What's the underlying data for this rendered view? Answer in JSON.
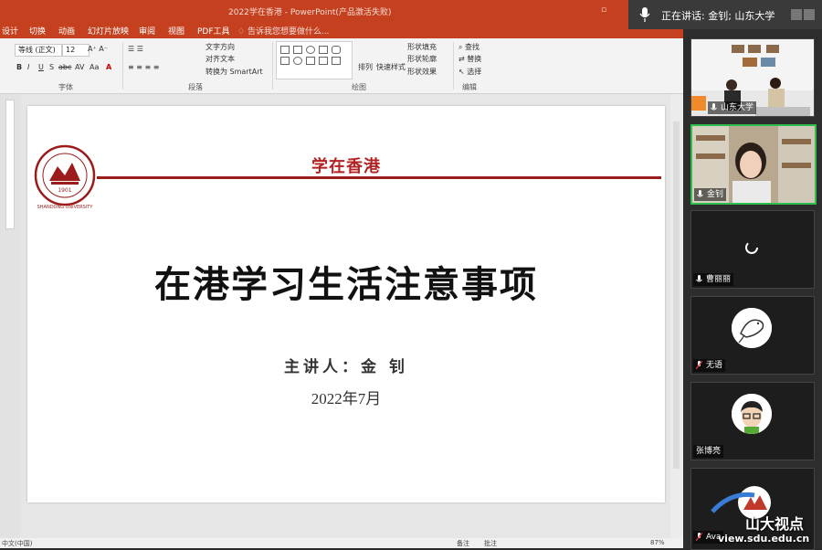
{
  "app": {
    "window_title": "2022学在香港 - PowerPoint(产品激活失败)",
    "tabs": [
      "设计",
      "切换",
      "动画",
      "幻灯片放映",
      "审阅",
      "视图",
      "PDF工具"
    ],
    "tell_me": "告诉我您想要做什么...",
    "ribbon": {
      "font_name": "等线 (正文)",
      "font_size": "12",
      "text_direction": "文字方向",
      "align_text": "对齐文本",
      "convert_smartart": "转换为 SmartArt",
      "arrange": "排列",
      "quick_styles": "快速样式",
      "shape_fill": "形状填充",
      "shape_outline": "形状轮廓",
      "shape_effects": "形状效果",
      "find": "查找",
      "replace": "替换",
      "select": "选择",
      "groups": [
        "字体",
        "段落",
        "绘图",
        "编辑"
      ]
    },
    "status": {
      "left": "中文(中国)",
      "notes": "备注",
      "comments": "批注",
      "zoom": "87%"
    }
  },
  "slide": {
    "header": "学在香港",
    "title": "在港学习生活注意事项",
    "speaker": "主讲人：金 钊",
    "date": "2022年7月",
    "logo_year": "1901",
    "logo_text": "SHANDONG UNIVERSITY",
    "accent_color": "#b22222"
  },
  "meeting": {
    "speaking_label": "正在讲话: 金钊; 山东大学",
    "participants": [
      {
        "name": "山东大学",
        "mic": "on"
      },
      {
        "name": "金钊",
        "mic": "on"
      },
      {
        "name": "曹丽丽",
        "mic": "on"
      },
      {
        "name": "无语",
        "mic": "off"
      },
      {
        "name": "张博亮",
        "mic": "none"
      },
      {
        "name": "Ava",
        "mic": "off"
      }
    ]
  },
  "watermark": {
    "brand": "山大视点",
    "url": "view.sdu.edu.cn"
  }
}
